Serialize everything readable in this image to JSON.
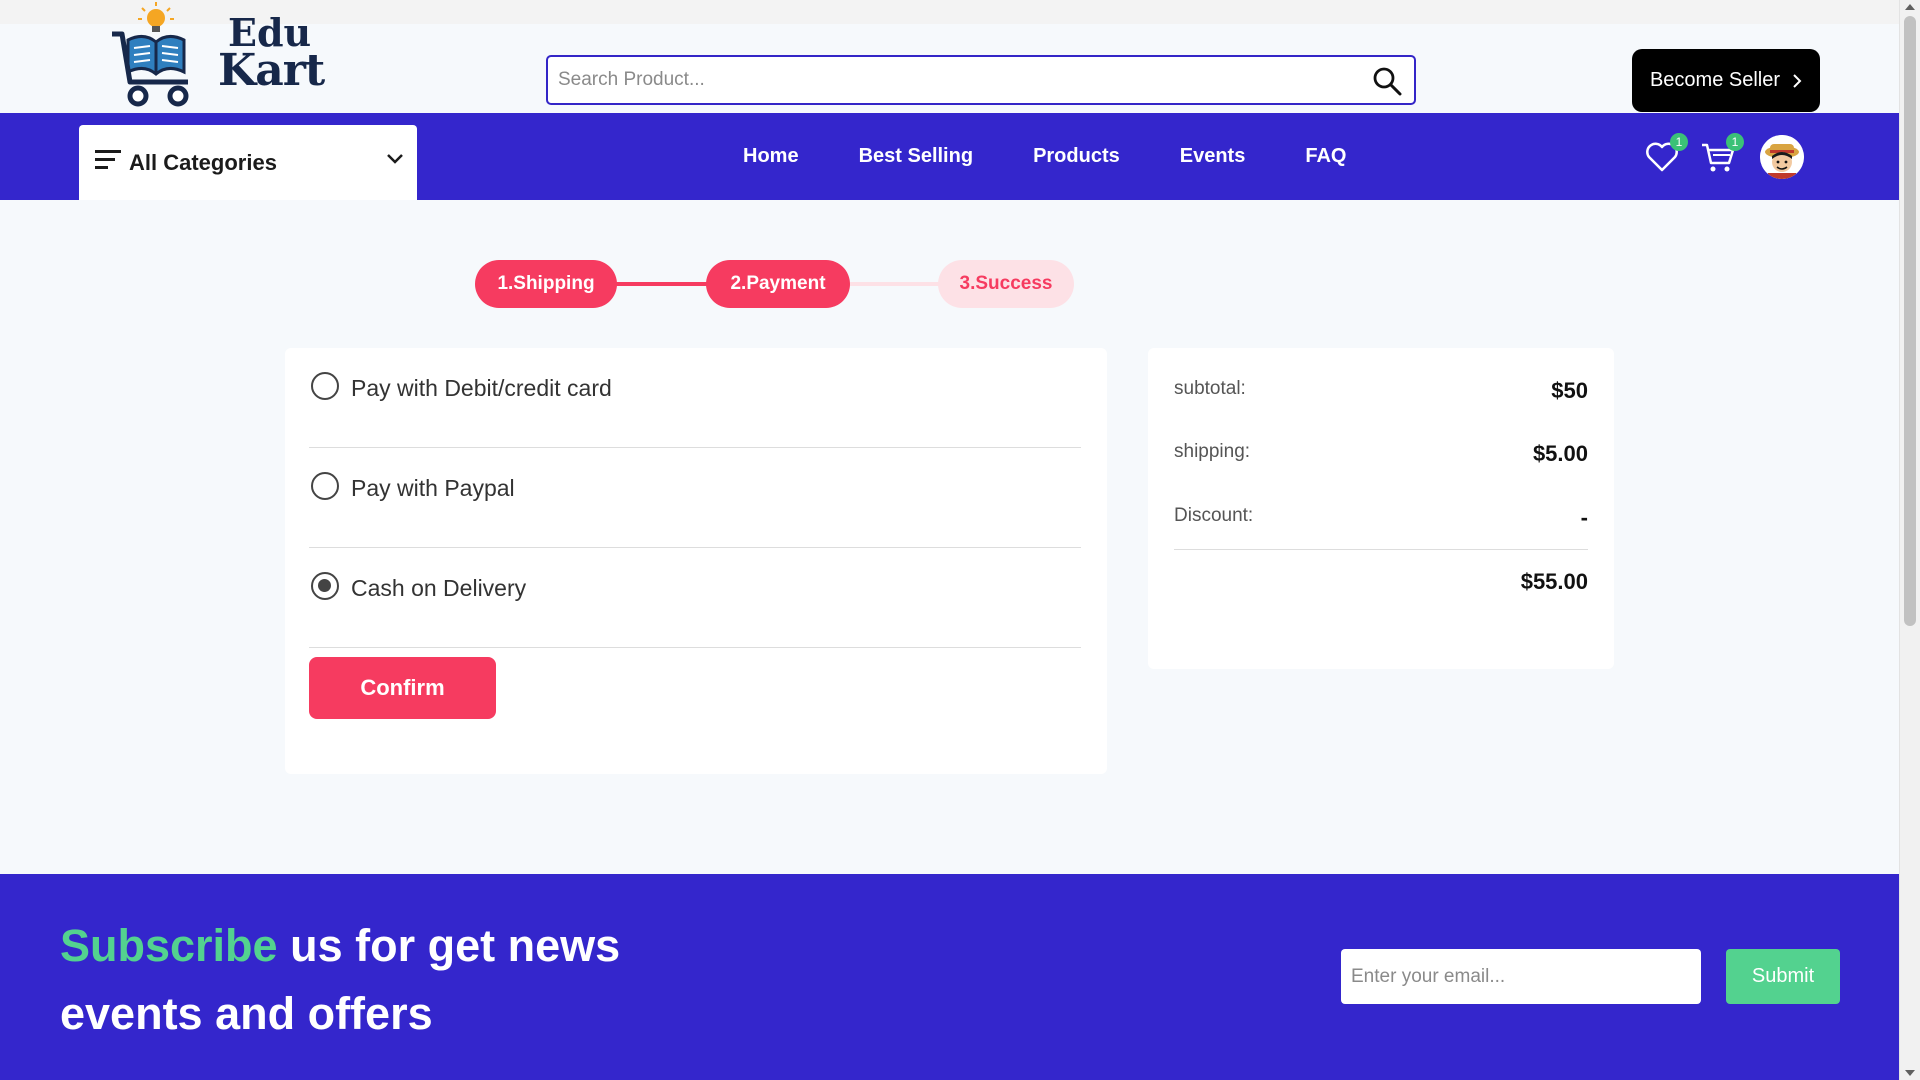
{
  "brand": {
    "line1": "Edu",
    "line2": "Kart"
  },
  "search": {
    "placeholder": "Search Product..."
  },
  "header": {
    "become_seller": "Become Seller"
  },
  "nav": {
    "categories_label": "All Categories",
    "links": [
      "Home",
      "Best Selling",
      "Products",
      "Events",
      "FAQ"
    ],
    "wishlist_count": "1",
    "cart_count": "1"
  },
  "steps": [
    {
      "label": "1.Shipping",
      "state": "active"
    },
    {
      "label": "2.Payment",
      "state": "active"
    },
    {
      "label": "3.Success",
      "state": "inactive"
    }
  ],
  "payment": {
    "options": [
      {
        "label": "Pay with Debit/credit card",
        "selected": false
      },
      {
        "label": "Pay with Paypal",
        "selected": false
      },
      {
        "label": "Cash on Delivery",
        "selected": true
      }
    ],
    "confirm_label": "Confirm"
  },
  "summary": {
    "subtotal_label": "subtotal:",
    "subtotal_value": "$50",
    "shipping_label": "shipping:",
    "shipping_value": "$5.00",
    "discount_label": "Discount:",
    "discount_value": "-",
    "total_value": "$55.00"
  },
  "footer": {
    "subscribe_highlight": "Subscribe",
    "subscribe_rest": " us for get news events and offers",
    "email_placeholder": "Enter your email...",
    "submit_label": "Submit"
  },
  "colors": {
    "nav_bg": "#3426cc",
    "accent": "#f63b60",
    "accent_light": "#fde1e6",
    "green": "#53d28f",
    "badge": "#3bc177"
  }
}
